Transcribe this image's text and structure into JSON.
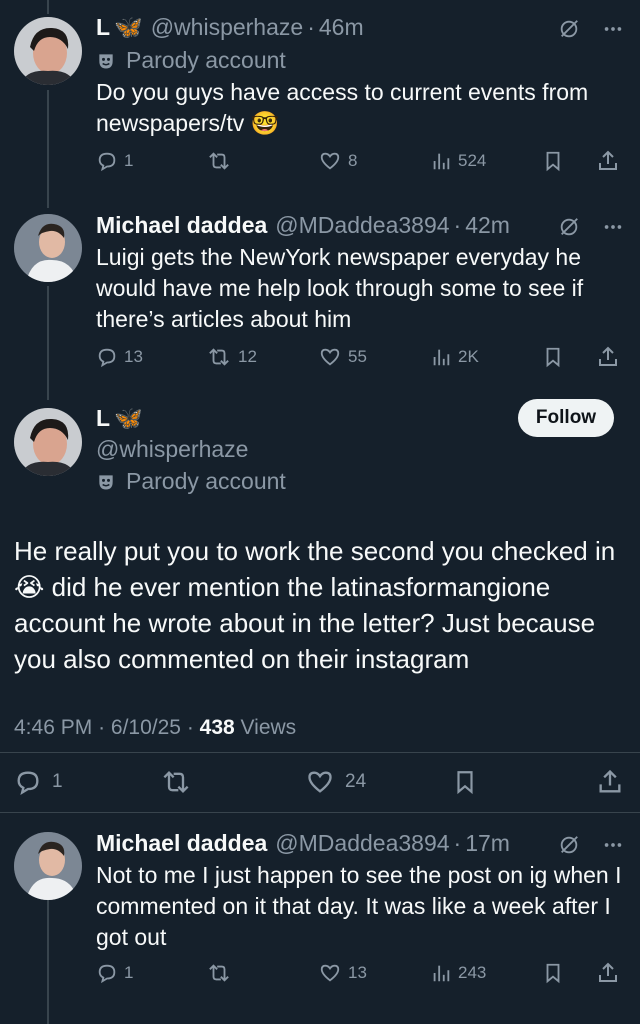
{
  "tweets": [
    {
      "name": "L",
      "name_emoji": "🦋",
      "handle": "@whisperhaze",
      "time": "46m",
      "parody": "Parody account",
      "text": "Do you guys have access to current events from newspapers/tv 🤓",
      "replies": "1",
      "retweets": "",
      "likes": "8",
      "views": "524"
    },
    {
      "name": "Michael daddea",
      "handle": "@MDaddea3894",
      "time": "42m",
      "text": "Luigi gets the NewYork newspaper everyday he would have me help look through some to see if there’s articles about him",
      "replies": "13",
      "retweets": "12",
      "likes": "55",
      "views": "2K"
    }
  ],
  "main_tweet": {
    "name": "L",
    "name_emoji": "🦋",
    "handle": "@whisperhaze",
    "parody": "Parody account",
    "follow_label": "Follow",
    "text": "He really put you to work the second you checked in 😭 did he ever mention the latinasformangione account he wrote about in the letter? Just because you also commented on their instagram",
    "time": "4:46 PM",
    "date": "6/10/25",
    "views_count": "438",
    "views_label": "Views",
    "replies": "1",
    "likes": "24"
  },
  "reply": {
    "name": "Michael daddea",
    "handle": "@MDaddea3894",
    "time": "17m",
    "text": "Not to me I just happen to see the post on ig when I commented on it that day. It was like a week after I got out",
    "replies": "1",
    "likes": "13",
    "views": "243"
  },
  "colors": {
    "background": "#15202b",
    "text": "#f7f9f9",
    "muted": "#8b98a5",
    "divider": "#38444d",
    "follow_bg": "#eff3f4"
  }
}
